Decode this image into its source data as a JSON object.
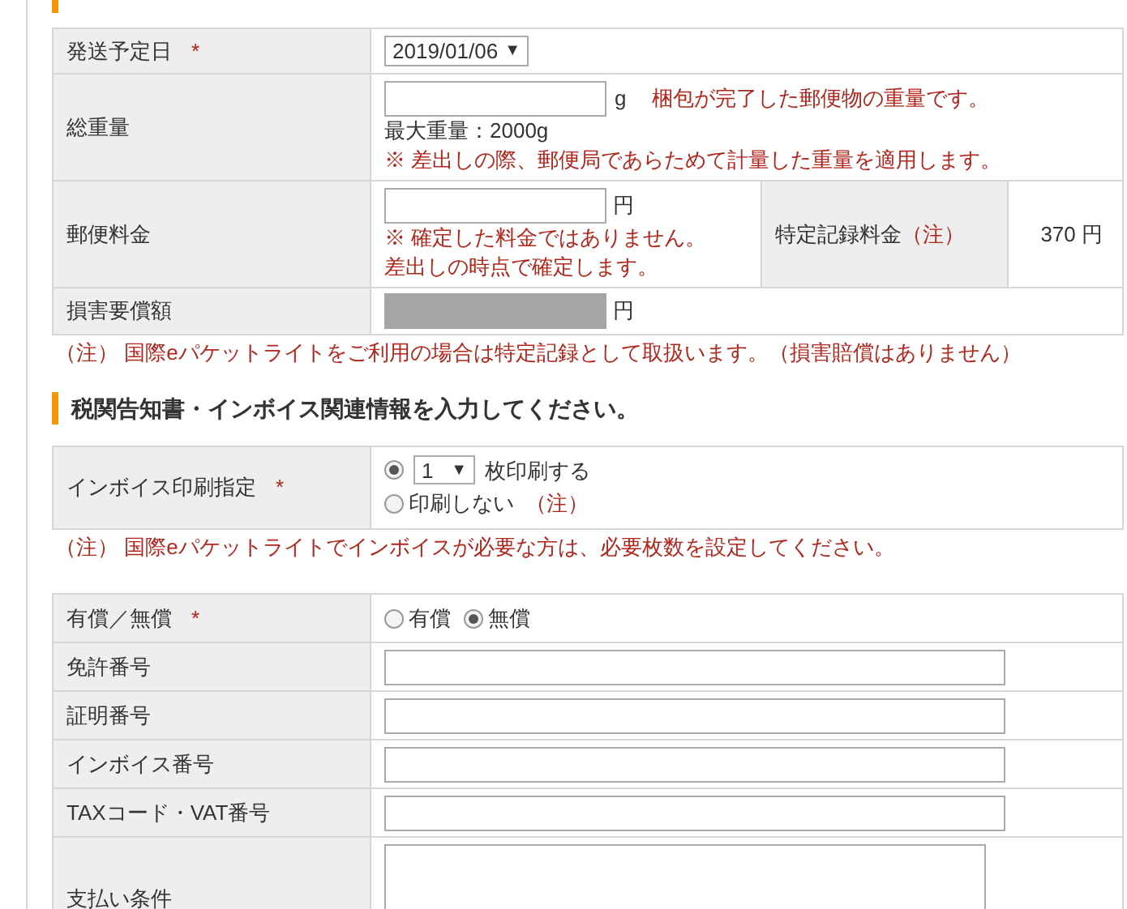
{
  "shipping": {
    "date": {
      "label": "発送予定日",
      "required_mark": "*",
      "value": "2019/01/06",
      "caret": "▼"
    },
    "weight": {
      "label": "総重量",
      "unit": "g",
      "hint": "梱包が完了した郵便物の重量です。",
      "max": "最大重量：2000g",
      "note": "※ 差出しの際、郵便局であらためて計量した重量を適用します。"
    },
    "postage": {
      "label": "郵便料金",
      "unit": "円",
      "notes": [
        "※ 確定した料金ではありません。",
        "差出しの時点で確定します。"
      ],
      "fee_label": "特定記録料金",
      "fee_note": "（注）",
      "fee_value": "370 円"
    },
    "damage": {
      "label": "損害要償額",
      "unit": "円",
      "disabled": true
    }
  },
  "shipping_note": "（注） 国際eパケットライトをご利用の場合は特定記録として取扱います。（損害賠償はありません）",
  "invoice": {
    "heading": "税関告知書・インボイス関連情報を入力してください。",
    "label": "インボイス印刷指定",
    "required_mark": "*",
    "options": [
      {
        "kind": "copies",
        "selected": true,
        "value": "1",
        "caret": "▼",
        "text": "枚印刷する"
      },
      {
        "kind": "none",
        "selected": false,
        "text": "印刷しない",
        "note": "（注）"
      }
    ],
    "note": "（注） 国際eパケットライトでインボイスが必要な方は、必要枚数を設定してください。"
  },
  "customs": {
    "paid": {
      "label": "有償／無償",
      "required_mark": "*",
      "options": [
        {
          "label": "有償",
          "selected": false
        },
        {
          "label": "無償",
          "selected": true
        }
      ]
    },
    "fields": [
      {
        "label": "免許番号"
      },
      {
        "label": "証明番号"
      },
      {
        "label": "インボイス番号"
      },
      {
        "label": "TAXコード・VAT番号"
      }
    ],
    "terms": {
      "label": "支払い条件"
    }
  }
}
